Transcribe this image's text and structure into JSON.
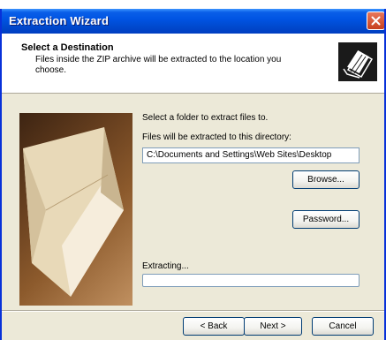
{
  "window": {
    "title": "Extraction Wizard"
  },
  "header": {
    "title": "Select a Destination",
    "subtitle": "Files inside the ZIP archive will be extracted to the location you choose."
  },
  "main": {
    "instruction": "Select a folder to extract files to.",
    "path_label": "Files will be extracted to this directory:",
    "path_value": "C:\\Documents and Settings\\Web Sites\\Desktop",
    "browse_label": "Browse...",
    "password_label": "Password...",
    "extracting_label": "Extracting...",
    "progress": 0
  },
  "footer": {
    "back_label": "< Back",
    "next_label": "Next >",
    "cancel_label": "Cancel"
  },
  "colors": {
    "titlebar": "#0054e3",
    "window_bg": "#ece9d8",
    "close": "#c7401e"
  }
}
